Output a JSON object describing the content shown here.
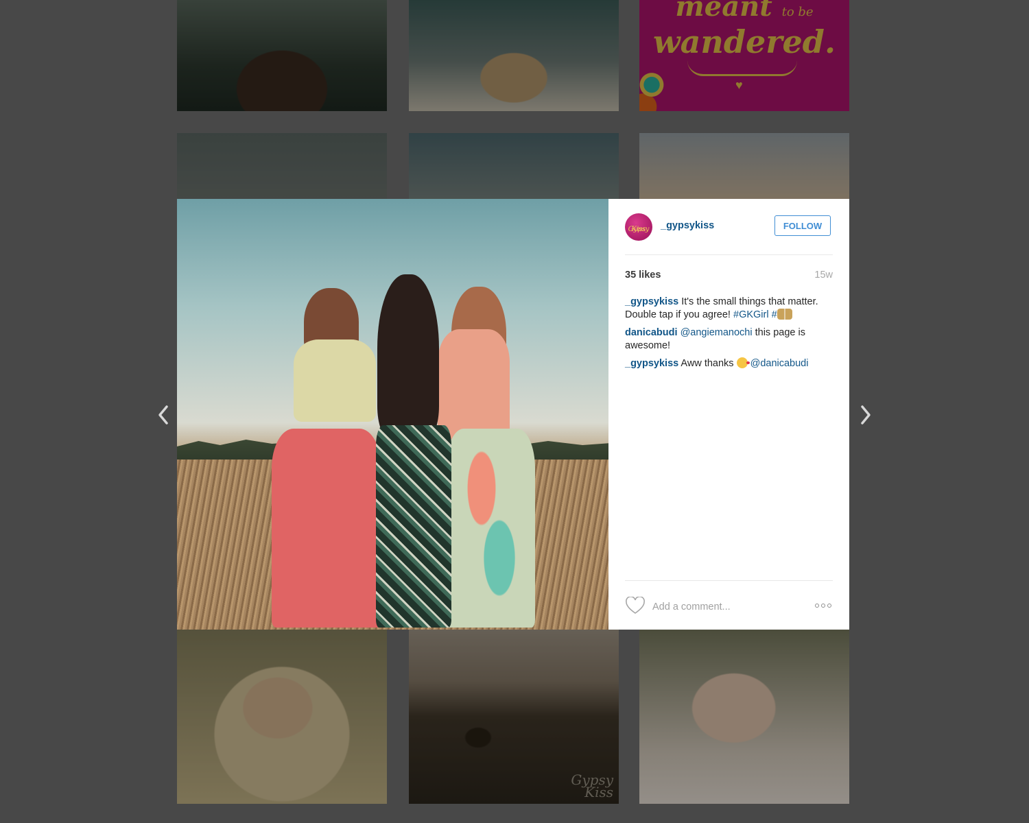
{
  "grid": {
    "top_right_tile": {
      "line1": "meant",
      "line1_small": "to be",
      "line2": "wandered."
    },
    "watermark": [
      "Gypsy",
      "Kiss"
    ]
  },
  "post": {
    "username": "_gypsykiss",
    "avatar_text": [
      "Gypsy",
      "Kiss"
    ],
    "follow_label": "FOLLOW",
    "likes": "35 likes",
    "age": "15w",
    "comments": [
      {
        "user": "_gypsykiss",
        "text": " It's the small things that matter. Double tap if you agree! ",
        "hashtag": "#GKGirl",
        "hashtag2": "#"
      },
      {
        "user": "danicabudi",
        "mention": "@angiemanochi",
        "text": " this page is awesome!"
      },
      {
        "user": "_gypsykiss",
        "text": " Aww thanks ",
        "mention": "@danicabudi"
      }
    ],
    "comment_placeholder": "Add a comment..."
  },
  "icons": {
    "prev": "chevron-left-icon",
    "next": "chevron-right-icon",
    "like": "heart-outline-icon",
    "more": "more-options-icon",
    "emoji_duo": "dancers-emoji",
    "emoji_kiss": "kiss-face-emoji"
  },
  "colors": {
    "link": "#125688",
    "follow": "#3f8dd4",
    "backdrop": "#484848"
  }
}
